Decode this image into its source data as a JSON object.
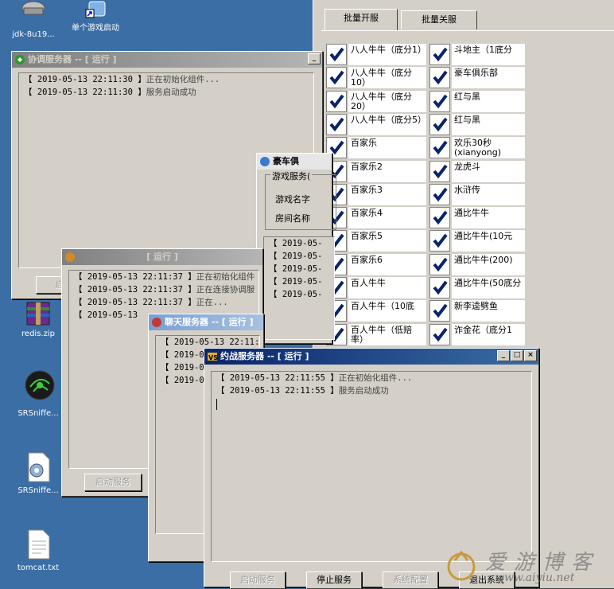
{
  "desktop": {
    "icons": [
      {
        "label": "jdk-8u19...",
        "icon": "installer-icon"
      },
      {
        "label": "单个游戏启动",
        "icon": "shortcut-icon"
      },
      {
        "label": "redis.zip",
        "icon": "archive-icon"
      },
      {
        "label": "SRSniffe...",
        "icon": "sniffer-icon"
      },
      {
        "label": "SRSniffe...",
        "icon": "settings-file-icon"
      },
      {
        "label": "tomcat.txt",
        "icon": "text-file-icon"
      }
    ]
  },
  "batch_panel": {
    "tabs": [
      "批量开服",
      "批量关服"
    ],
    "left_games": [
      "八人牛牛（底分1）",
      "八人牛牛（底分10）",
      "八人牛牛（底分20）",
      "八人牛牛（底分5）",
      "百家乐",
      "百家乐2",
      "百家乐3",
      "百家乐4",
      "百家乐5",
      "百家乐6",
      "百人牛牛",
      "百人牛牛（10底",
      "百人牛牛（低赔率）"
    ],
    "right_games": [
      "斗地主（1底分",
      "豪车俱乐部",
      "红与黑",
      "红与黑",
      "欢乐30秒(xianyong)",
      "龙虎斗",
      "水浒传",
      "通比牛牛",
      "通比牛牛(10元",
      "通比牛牛(200)",
      "通比牛牛(50底分",
      "新李逵劈鱼",
      "诈金花（底分1"
    ]
  },
  "coord_window": {
    "title": "协调服务器 -- [ 运行 ]",
    "logs": [
      {
        "time": "【 2019-05-13 22:11:30 】",
        "msg": "正在初始化组件..."
      },
      {
        "time": "【 2019-05-13 22:11:30 】",
        "msg": "服务启动成功"
      }
    ],
    "button": "启"
  },
  "room_window": {
    "title": "豪车俱",
    "group_label": "游戏服务(",
    "game_name_label": "游戏名字",
    "room_name_label": "房间名称",
    "logs": [
      "【 2019-05-",
      "【 2019-05-",
      "【 2019-05-",
      "【 2019-05-",
      "【 2019-05-"
    ]
  },
  "second_window": {
    "title": "[ 运行 ]",
    "logs": [
      {
        "time": "【 2019-05-13 22:11:37 】",
        "msg": "正在初始化组件"
      },
      {
        "time": "【 2019-05-13 22:11:37 】",
        "msg": "正在连接协调服"
      },
      {
        "time": "【 2019-05-13 22:11:37 】",
        "msg": "正在..."
      },
      {
        "time": "【 2019-05-13",
        "msg": ""
      }
    ],
    "button": "启动服务"
  },
  "chat_window": {
    "title": "聊天服务器 -- [ 运行 ]",
    "logs": [
      "【 2019-05-13 22:11:42",
      "【 2019-05",
      "【 2019-05",
      "【 2019-05"
    ]
  },
  "match_window": {
    "title": "约战服务器 -- [ 运行 ]",
    "logs": [
      {
        "time": "【 2019-05-13 22:11:55 】",
        "msg": "正在初始化组件..."
      },
      {
        "time": "【 2019-05-13 22:11:55 】",
        "msg": "服务启动成功"
      }
    ],
    "buttons": {
      "start": "启动服务",
      "stop": "停止服务",
      "config": "系统配置",
      "exit": "退出系统"
    }
  },
  "watermark": {
    "text": "爱游博客",
    "url": "www.aiyiu.net"
  },
  "colors": {
    "desktop": "#3a6ea5",
    "titlebar_active": "#0a246a",
    "window_face": "#d4d0c8",
    "check": "#0a246a"
  }
}
